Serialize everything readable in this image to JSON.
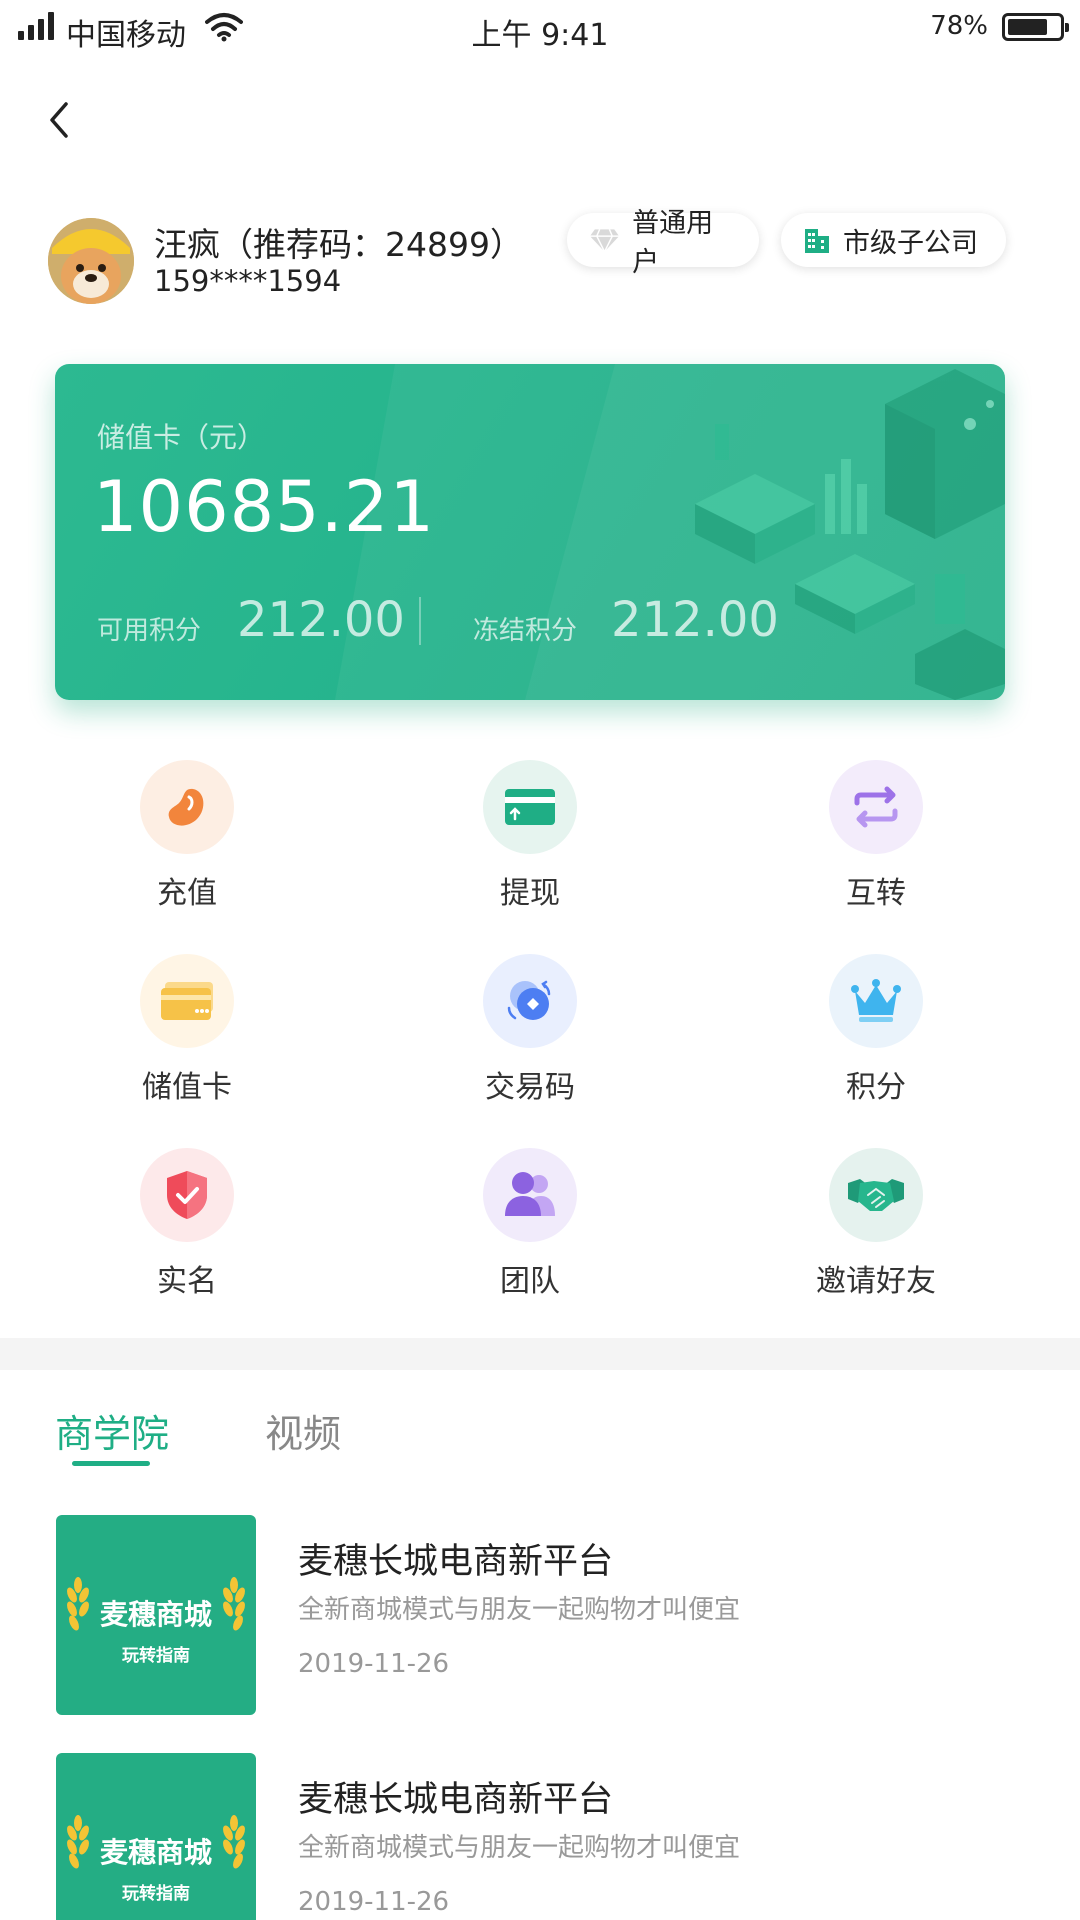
{
  "status_bar": {
    "carrier": "中国移动",
    "time": "上午 9:41",
    "battery": "78%",
    "battery_level": 0.78
  },
  "profile": {
    "name": "汪疯（推荐码：24899）",
    "phone": "159****1594",
    "badges": [
      {
        "label": "普通用户",
        "icon": "diamond-icon"
      },
      {
        "label": "市级子公司",
        "icon": "building-icon"
      }
    ]
  },
  "card": {
    "label": "储值卡（元）",
    "amount": "10685.21",
    "available_label": "可用积分",
    "available_value": "212.00",
    "frozen_label": "冻结积分",
    "frozen_value": "212.00"
  },
  "actions": [
    {
      "label": "充值",
      "icon": "bean-icon",
      "bg": "#fdeee3",
      "color": "#f2853c"
    },
    {
      "label": "提现",
      "icon": "withdraw-card-icon",
      "bg": "#e6f4ef",
      "color": "#1fae85"
    },
    {
      "label": "互转",
      "icon": "transfer-arrows-icon",
      "bg": "#f3ecfb",
      "color": "#9d72e8"
    },
    {
      "label": "储值卡",
      "icon": "stored-card-icon",
      "bg": "#fff5e5",
      "color": "#f6c248"
    },
    {
      "label": "交易码",
      "icon": "coin-exchange-icon",
      "bg": "#e9effe",
      "color": "#4d7ef2"
    },
    {
      "label": "积分",
      "icon": "crown-icon",
      "bg": "#eaf3fb",
      "color": "#3fb4ee"
    },
    {
      "label": "实名",
      "icon": "shield-check-icon",
      "bg": "#fde9ea",
      "color": "#ef4b5a"
    },
    {
      "label": "团队",
      "icon": "team-icon",
      "bg": "#f1ebfb",
      "color": "#8c62e0"
    },
    {
      "label": "邀请好友",
      "icon": "handshake-icon",
      "bg": "#e5f2ee",
      "color": "#1f9a78"
    }
  ],
  "tabs": [
    {
      "label": "商学院",
      "active": true
    },
    {
      "label": "视频",
      "active": false
    }
  ],
  "articles": [
    {
      "thumb_title": "麦穗商城",
      "thumb_sub": "玩转指南",
      "title": "麦穗长城电商新平台",
      "desc": "全新商城模式与朋友一起购物才叫便宜",
      "date": "2019-11-26"
    },
    {
      "thumb_title": "麦穗商城",
      "thumb_sub": "玩转指南",
      "title": "麦穗长城电商新平台",
      "desc": "全新商城模式与朋友一起购物才叫便宜",
      "date": "2019-11-26"
    }
  ]
}
